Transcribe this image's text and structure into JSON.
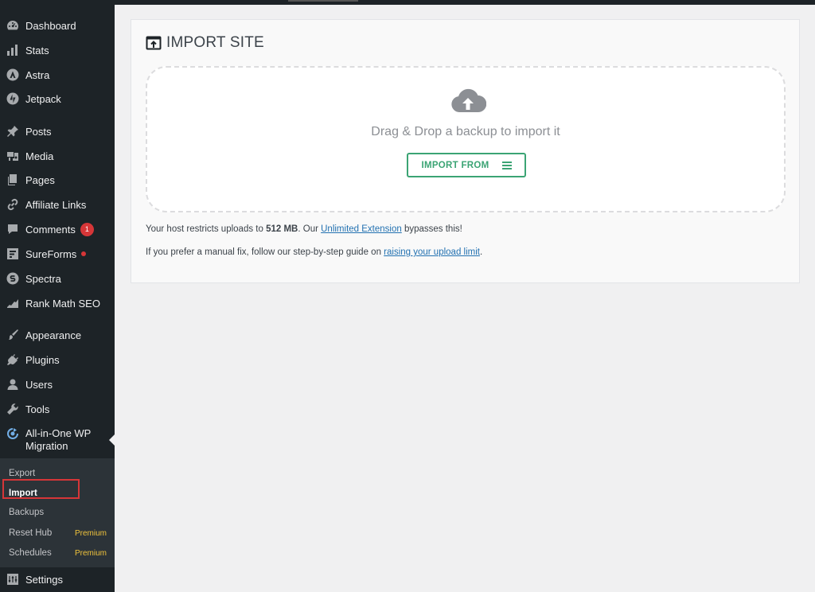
{
  "sidebar": {
    "items": [
      {
        "label": "Dashboard",
        "icon": "dashboard-icon"
      },
      {
        "label": "Stats",
        "icon": "stats-icon"
      },
      {
        "label": "Astra",
        "icon": "astra-icon"
      },
      {
        "label": "Jetpack",
        "icon": "jetpack-icon"
      },
      {
        "label": "Posts",
        "icon": "pin-icon"
      },
      {
        "label": "Media",
        "icon": "media-icon"
      },
      {
        "label": "Pages",
        "icon": "pages-icon"
      },
      {
        "label": "Affiliate Links",
        "icon": "link-icon"
      },
      {
        "label": "Comments",
        "icon": "comment-icon",
        "badge": "1"
      },
      {
        "label": "SureForms",
        "icon": "sureforms-icon"
      },
      {
        "label": "Spectra",
        "icon": "spectra-icon"
      },
      {
        "label": "Rank Math SEO",
        "icon": "rankmath-icon"
      },
      {
        "label": "Appearance",
        "icon": "brush-icon"
      },
      {
        "label": "Plugins",
        "icon": "plugin-icon"
      },
      {
        "label": "Users",
        "icon": "user-icon"
      },
      {
        "label": "Tools",
        "icon": "wrench-icon"
      },
      {
        "label": "All-in-One WP Migration",
        "icon": "migration-icon"
      },
      {
        "label": "Settings",
        "icon": "settings-icon"
      }
    ],
    "submenu": [
      {
        "label": "Export"
      },
      {
        "label": "Import"
      },
      {
        "label": "Backups"
      },
      {
        "label": "Reset Hub",
        "tag": "Premium"
      },
      {
        "label": "Schedules",
        "tag": "Premium"
      }
    ]
  },
  "main": {
    "title": "IMPORT SITE",
    "drop_text": "Drag & Drop a backup to import it",
    "import_button": "IMPORT FROM",
    "info1": {
      "prefix": "Your host restricts uploads to ",
      "limit": "512 MB",
      "middle": ". Our ",
      "link": "Unlimited Extension",
      "suffix": " bypasses this!"
    },
    "info2": {
      "prefix": "If you prefer a manual fix, follow our step-by-step guide on ",
      "link": "raising your upload limit",
      "suffix": "."
    }
  },
  "colors": {
    "sidebar_bg": "#1d2327",
    "submenu_bg": "#2c3338",
    "accent_green": "#3ba474",
    "link_blue": "#2271b1",
    "badge_red": "#d63638",
    "premium_yellow": "#f0c33c"
  }
}
